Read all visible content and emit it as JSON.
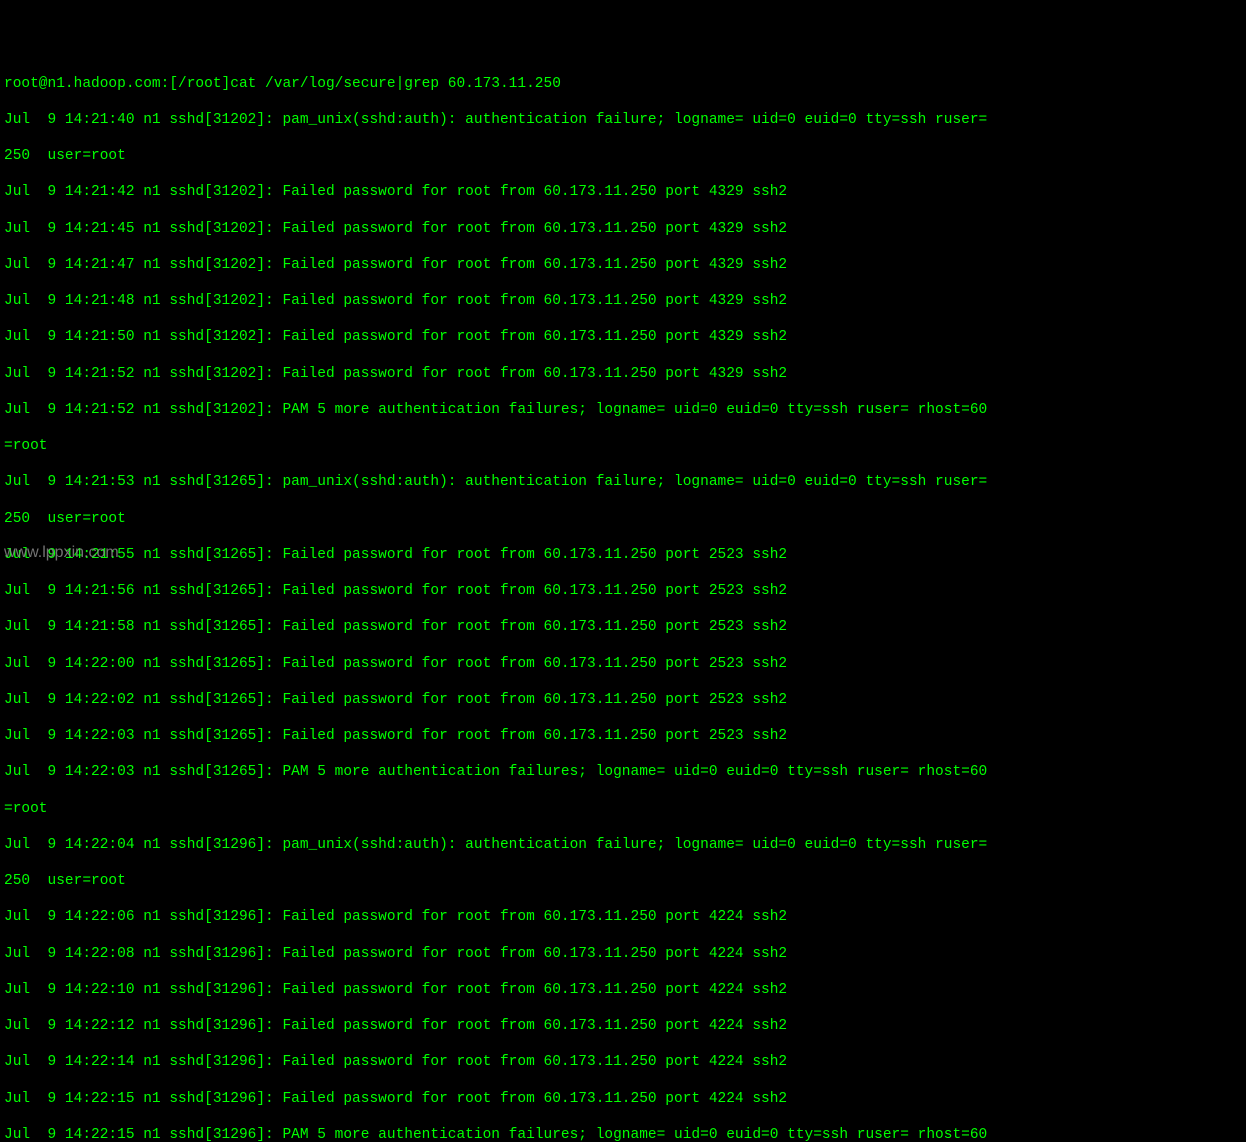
{
  "prompt": "root@n1.hadoop.com:[/root]cat /var/log/secure|grep 60.173.11.250",
  "lines": [
    "Jul  9 14:21:40 n1 sshd[31202]: pam_unix(sshd:auth): authentication failure; logname= uid=0 euid=0 tty=ssh ruser=",
    "250  user=root",
    "Jul  9 14:21:42 n1 sshd[31202]: Failed password for root from 60.173.11.250 port 4329 ssh2",
    "Jul  9 14:21:45 n1 sshd[31202]: Failed password for root from 60.173.11.250 port 4329 ssh2",
    "Jul  9 14:21:47 n1 sshd[31202]: Failed password for root from 60.173.11.250 port 4329 ssh2",
    "Jul  9 14:21:48 n1 sshd[31202]: Failed password for root from 60.173.11.250 port 4329 ssh2",
    "Jul  9 14:21:50 n1 sshd[31202]: Failed password for root from 60.173.11.250 port 4329 ssh2",
    "Jul  9 14:21:52 n1 sshd[31202]: Failed password for root from 60.173.11.250 port 4329 ssh2",
    "Jul  9 14:21:52 n1 sshd[31202]: PAM 5 more authentication failures; logname= uid=0 euid=0 tty=ssh ruser= rhost=60",
    "=root",
    "Jul  9 14:21:53 n1 sshd[31265]: pam_unix(sshd:auth): authentication failure; logname= uid=0 euid=0 tty=ssh ruser=",
    "250  user=root",
    "Jul  9 14:21:55 n1 sshd[31265]: Failed password for root from 60.173.11.250 port 2523 ssh2",
    "Jul  9 14:21:56 n1 sshd[31265]: Failed password for root from 60.173.11.250 port 2523 ssh2",
    "Jul  9 14:21:58 n1 sshd[31265]: Failed password for root from 60.173.11.250 port 2523 ssh2",
    "Jul  9 14:22:00 n1 sshd[31265]: Failed password for root from 60.173.11.250 port 2523 ssh2",
    "Jul  9 14:22:02 n1 sshd[31265]: Failed password for root from 60.173.11.250 port 2523 ssh2",
    "Jul  9 14:22:03 n1 sshd[31265]: Failed password for root from 60.173.11.250 port 2523 ssh2",
    "Jul  9 14:22:03 n1 sshd[31265]: PAM 5 more authentication failures; logname= uid=0 euid=0 tty=ssh ruser= rhost=60",
    "=root",
    "Jul  9 14:22:04 n1 sshd[31296]: pam_unix(sshd:auth): authentication failure; logname= uid=0 euid=0 tty=ssh ruser=",
    "250  user=root",
    "Jul  9 14:22:06 n1 sshd[31296]: Failed password for root from 60.173.11.250 port 4224 ssh2",
    "Jul  9 14:22:08 n1 sshd[31296]: Failed password for root from 60.173.11.250 port 4224 ssh2",
    "Jul  9 14:22:10 n1 sshd[31296]: Failed password for root from 60.173.11.250 port 4224 ssh2",
    "Jul  9 14:22:12 n1 sshd[31296]: Failed password for root from 60.173.11.250 port 4224 ssh2",
    "Jul  9 14:22:14 n1 sshd[31296]: Failed password for root from 60.173.11.250 port 4224 ssh2",
    "Jul  9 14:22:15 n1 sshd[31296]: Failed password for root from 60.173.11.250 port 4224 ssh2",
    "Jul  9 14:22:15 n1 sshd[31296]: PAM 5 more authentication failures; logname= uid=0 euid=0 tty=ssh ruser= rhost=60"
  ],
  "watermark": "www.lppxin.com"
}
